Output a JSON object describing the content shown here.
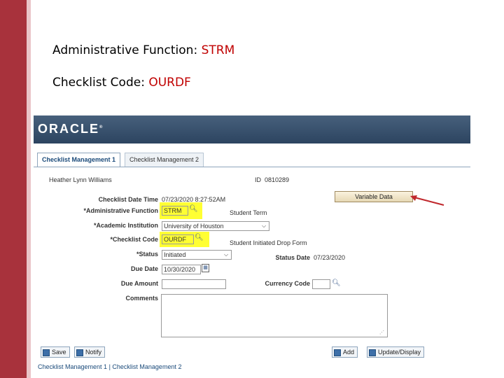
{
  "slide": {
    "line1_label": "Administrative Function: ",
    "line1_value": "STRM",
    "line2_label": "Checklist Code: ",
    "line2_value": "OURDF"
  },
  "brand": {
    "logo": "ORACLE",
    "trademark": "®"
  },
  "tabs": [
    {
      "label": "Checklist Management 1",
      "active": true
    },
    {
      "label": "Checklist Management 2",
      "active": false
    }
  ],
  "person": {
    "name": "Heather Lynn Williams",
    "id_label": "ID",
    "id_value": "0810289"
  },
  "variable_data_button": "Variable Data",
  "form": {
    "checklist_datetime_label": "Checklist Date Time",
    "checklist_datetime_value": "07/23/2020 8:27:52AM",
    "admin_function_label": "*Administrative Function",
    "admin_function_value": "STRM",
    "admin_function_desc": "Student Term",
    "academic_institution_label": "*Academic Institution",
    "academic_institution_value": "University of Houston",
    "checklist_code_label": "*Checklist Code",
    "checklist_code_value": "OURDF",
    "checklist_code_desc": "Student Initiated Drop Form",
    "status_label": "*Status",
    "status_value": "Initiated",
    "status_date_label": "Status Date",
    "status_date_value": "07/23/2020",
    "due_date_label": "Due Date",
    "due_date_value": "10/30/2020",
    "due_amount_label": "Due Amount",
    "due_amount_value": "",
    "currency_code_label": "Currency Code",
    "currency_code_value": "",
    "comments_label": "Comments",
    "comments_value": ""
  },
  "toolbar": {
    "save": "Save",
    "notify": "Notify",
    "add": "Add",
    "update_display": "Update/Display"
  },
  "bottom_links": {
    "link1": "Checklist Management 1",
    "separator": " | ",
    "link2": "Checklist Management 2"
  },
  "colors": {
    "accent": "#a8323c",
    "highlight_value": "#c00000",
    "field_highlight": "#ffff33",
    "arrow": "#c0282d"
  }
}
